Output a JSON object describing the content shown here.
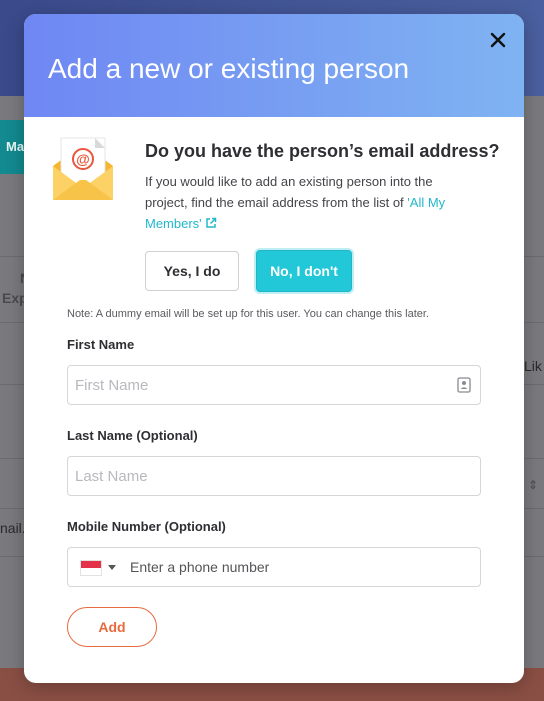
{
  "background": {
    "tab_label": "Ma",
    "left_text_line1": "N",
    "left_text_line2": "Exp",
    "left_email_fragment": "nail.",
    "right_text_fragment": "Lik"
  },
  "modal": {
    "title": "Add a new or existing person",
    "close_icon": "close-icon",
    "question": "Do you have the person’s email address?",
    "explain_text": "If you would like to add an existing person into the project, find the email address from the list of ",
    "members_link": "'All My Members'",
    "yes_label": "Yes, I do",
    "no_label": "No, I don't",
    "selected_option": "No, I don't",
    "note": "Note: A dummy email will be set up for this user. You can change this later.",
    "first_name": {
      "label": "First Name",
      "placeholder": "First Name",
      "value": ""
    },
    "last_name": {
      "label": "Last Name (Optional)",
      "placeholder": "Last Name",
      "value": ""
    },
    "mobile": {
      "label": "Mobile Number (Optional)",
      "placeholder": "Enter a phone number",
      "value": "",
      "country_flag": "singapore-flag"
    },
    "add_label": "Add"
  },
  "colors": {
    "header_gradient_start": "#6f87f3",
    "header_gradient_end": "#7fb3f2",
    "accent_cyan": "#22c8d8",
    "link_cyan": "#22b8cc",
    "add_orange": "#e86a3f"
  }
}
